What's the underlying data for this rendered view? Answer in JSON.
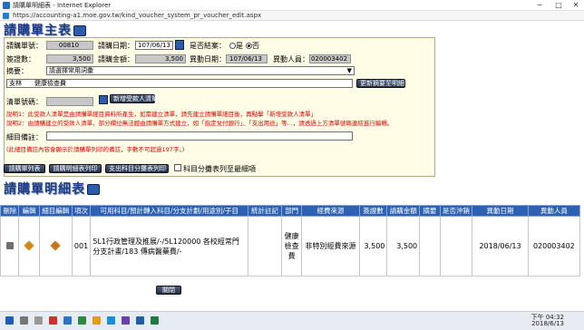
{
  "window": {
    "title": "請購單明細表 - Internet Explorer",
    "minimize": "─",
    "maximize": "□",
    "close": "✕"
  },
  "address": {
    "url": "https://accounting-a1.moe.gov.tw/kind_voucher_system_pr_voucher_edit.aspx"
  },
  "header": {
    "title": "請購單主表"
  },
  "form": {
    "voucher_no_label": "請購單號：",
    "voucher_no": "00810",
    "request_date_label": "請購日期：",
    "request_date": "107/06/13",
    "closed_label": "是否結案：",
    "closed_yes": "是",
    "closed_no": "否",
    "sign_amount_label": "簽證數：",
    "sign_amount": "3,500",
    "request_amount_label": "請購金額：",
    "request_amount": "3,500",
    "change_date_label": "異動日期：",
    "change_date": "107/06/13",
    "change_user_label": "異動人員：",
    "change_user": "020003402",
    "summary_label": "摘要：",
    "summary_select": "請選擇常用詞彙",
    "summary_text": "支林　　健康檢查費",
    "update_summary_button": "更新摘要至明細",
    "voucher_ref_label": "清單號碼：",
    "add_beneficiary_button": "新增受款人清單",
    "note1": "說明1：此受款人清單是由請購單經目資料所產生，如需建立清單，請先建立請購單細目後，再點擊「新增受款人清單」",
    "note2": "說明2：由請購建立的受款人清單，部分欄位無法經由請購單方式建立，如「指定兌付銀行」、「支出用途」等...，請透過上方清單號碼連結進行編輯。",
    "item_note_label": "細目備註：",
    "item_note_hint": "(此細目備註內容會顯示於請購單列印的備註，字數不可超過197字。)"
  },
  "actions": {
    "list_button": "請購單列表",
    "print_button": "請購明細表列印",
    "budget_print_button": "支出科目分攤表列印",
    "share_checkbox_label": "科目分攤表列至最細項"
  },
  "detail": {
    "title": "請購單明細表",
    "columns": [
      "刪除",
      "編輯",
      "細目編輯",
      "項次",
      "可用科目/預計轉入科目/分支計劃/用途別/子目",
      "統計註記",
      "部門",
      "經費來源",
      "簽證數",
      "請購金額",
      "摘要",
      "是否沖銷",
      "異動日期",
      "異動人員"
    ],
    "rows": [
      {
        "seq": "001",
        "account": "5L1行政管理及推展/-/5L120000 各校經常門分支計畫/183 傳病醫藥費/-",
        "stat_note": "",
        "dept": "健康檢查費",
        "fund": "非特別經費來源",
        "sign": "3,500",
        "amount": "3,500",
        "summary": "",
        "offset": "",
        "date": "2018/06/13",
        "user": "020003402"
      }
    ]
  },
  "footer": {
    "close_button": "關閉"
  },
  "taskbar": {
    "time": "下午 04:32",
    "date": "2018/6/13"
  },
  "colors": {
    "header_blue": "#2c61b3",
    "panel_bg": "#fffde6",
    "note_red": "#e00000"
  }
}
